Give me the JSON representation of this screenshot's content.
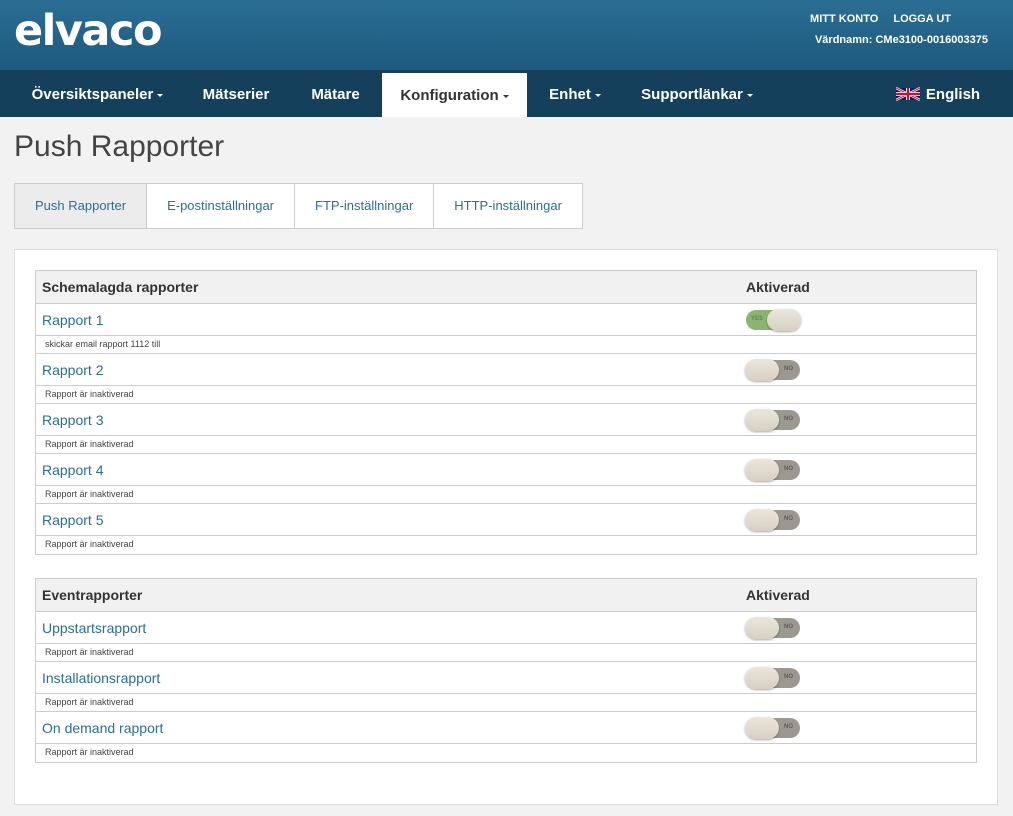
{
  "header": {
    "logo": "elvaco",
    "my_account": "MITT KONTO",
    "logout": "LOGGA UT",
    "hostname": "Värdnamn: CMe3100-0016003375"
  },
  "nav": {
    "items": [
      {
        "label": "Översiktspaneler",
        "dropdown": true
      },
      {
        "label": "Mätserier",
        "dropdown": false
      },
      {
        "label": "Mätare",
        "dropdown": false
      },
      {
        "label": "Konfiguration",
        "dropdown": true,
        "active": true
      },
      {
        "label": "Enhet",
        "dropdown": true
      },
      {
        "label": "Supportlänkar",
        "dropdown": true
      }
    ],
    "language": "English",
    "language_icon": "uk-flag-icon"
  },
  "page_title": "Push Rapporter",
  "tabs": [
    {
      "label": "Push Rapporter",
      "active": true
    },
    {
      "label": "E-postinställningar"
    },
    {
      "label": "FTP-inställningar"
    },
    {
      "label": "HTTP-inställningar"
    }
  ],
  "scheduled": {
    "col_name": "Schemalagda rapporter",
    "col_enabled": "Aktiverad",
    "rows": [
      {
        "name": "Rapport 1",
        "desc": "skickar email rapport 1112 till",
        "enabled": true,
        "toggle_label": "YES"
      },
      {
        "name": "Rapport 2",
        "desc": "Rapport är inaktiverad",
        "enabled": false,
        "toggle_label": "NO"
      },
      {
        "name": "Rapport 3",
        "desc": "Rapport är inaktiverad",
        "enabled": false,
        "toggle_label": "NO"
      },
      {
        "name": "Rapport 4",
        "desc": "Rapport är inaktiverad",
        "enabled": false,
        "toggle_label": "NO"
      },
      {
        "name": "Rapport 5",
        "desc": "Rapport är inaktiverad",
        "enabled": false,
        "toggle_label": "NO"
      }
    ]
  },
  "events": {
    "col_name": "Eventrapporter",
    "col_enabled": "Aktiverad",
    "rows": [
      {
        "name": "Uppstartsrapport",
        "desc": "Rapport är inaktiverad",
        "enabled": false,
        "toggle_label": "NO"
      },
      {
        "name": "Installationsrapport",
        "desc": "Rapport är inaktiverad",
        "enabled": false,
        "toggle_label": "NO"
      },
      {
        "name": "On demand rapport",
        "desc": "Rapport är inaktiverad",
        "enabled": false,
        "toggle_label": "NO"
      }
    ]
  }
}
